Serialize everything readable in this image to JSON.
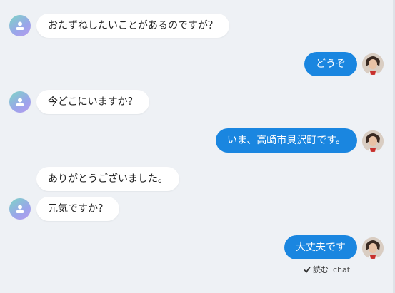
{
  "messages": [
    {
      "side": "in",
      "text": "おたずねしたいことがあるのですが？"
    },
    {
      "side": "out",
      "text": "どうぞ"
    },
    {
      "side": "in",
      "text": "今どこにいますか？"
    },
    {
      "side": "out",
      "text": "いま、高崎市貝沢町です。"
    },
    {
      "side": "in",
      "text": "ありがとうございました。"
    },
    {
      "side": "in",
      "text": "元気ですか？"
    },
    {
      "side": "out",
      "text": "大丈夫です"
    }
  ],
  "status": {
    "read": "読む",
    "source": "chat",
    "icon": "checkmark-icon"
  },
  "colors": {
    "background": "#eef1f5",
    "outgoing": "#1a86e0",
    "incoming": "#ffffff"
  }
}
